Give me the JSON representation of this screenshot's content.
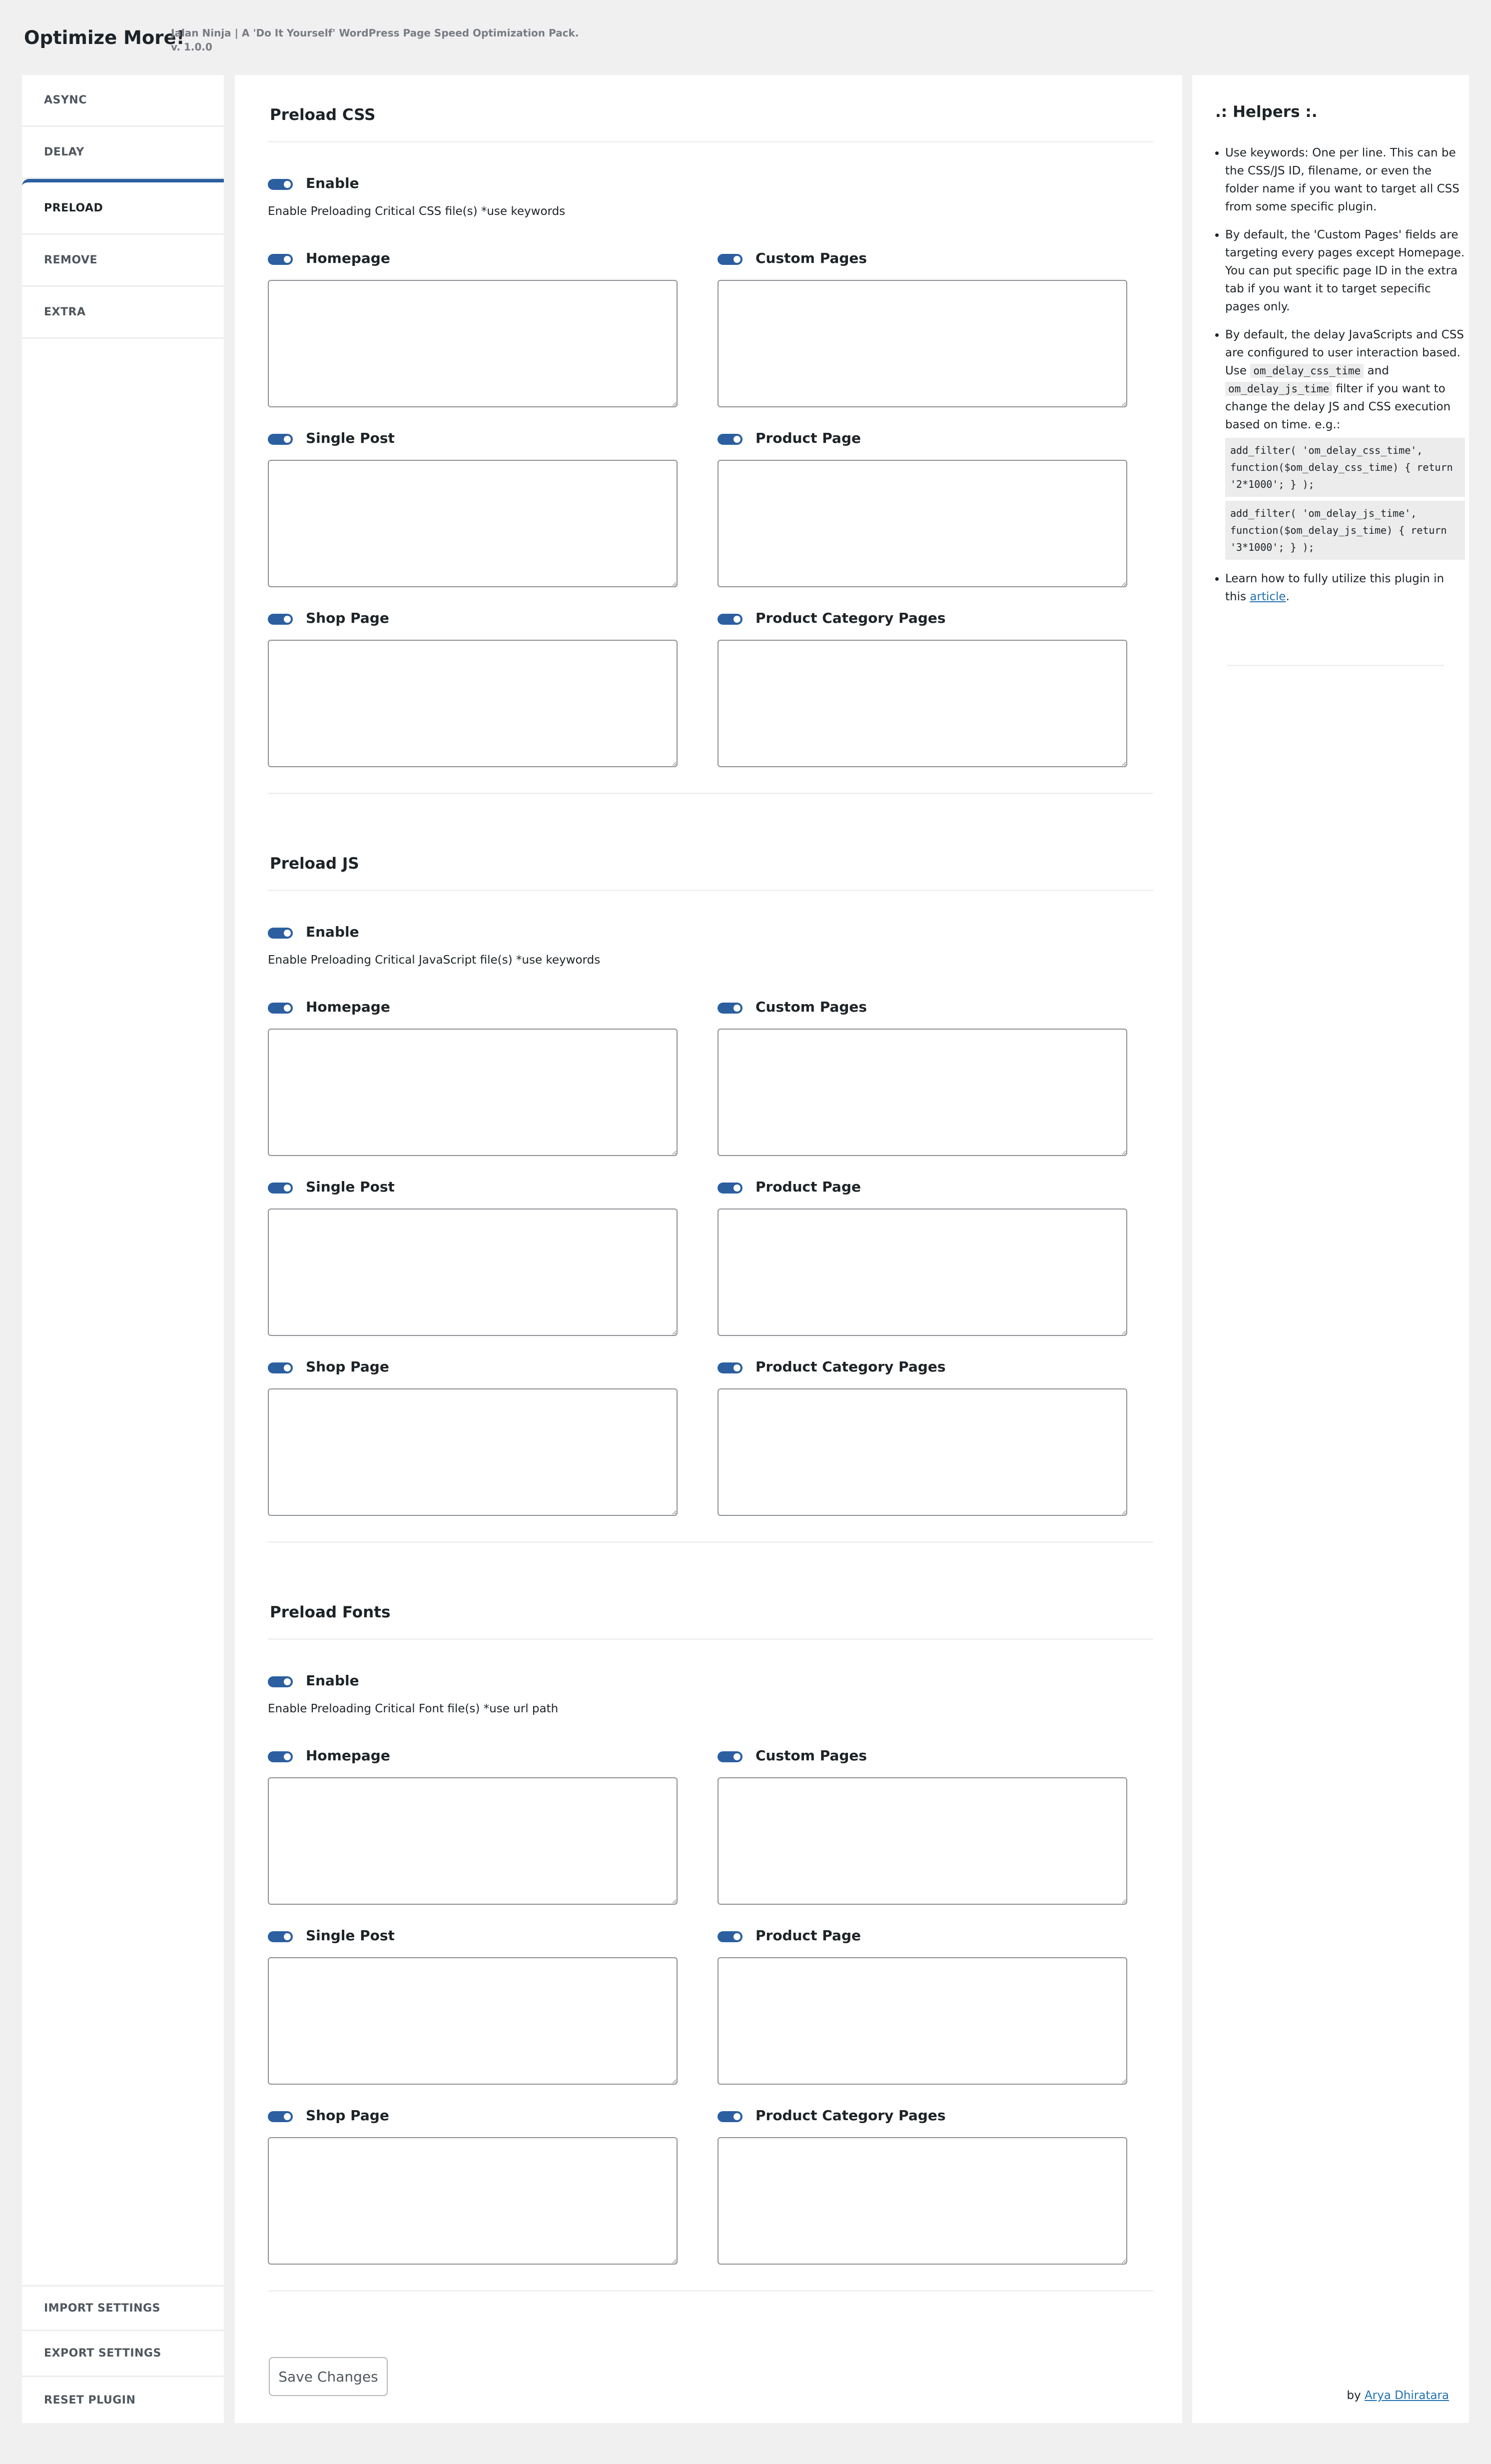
{
  "header": {
    "brand": "Optimize More!",
    "tagline": "Jalan Ninja | A 'Do It Yourself' WordPress Page Speed Optimization Pack.",
    "version": "v. 1.0.0"
  },
  "nav": {
    "items": [
      {
        "label": "ASYNC"
      },
      {
        "label": "DELAY"
      },
      {
        "label": "PRELOAD"
      },
      {
        "label": "REMOVE"
      },
      {
        "label": "EXTRA"
      }
    ],
    "active": "PRELOAD",
    "bottom_items": [
      {
        "label": "IMPORT SETTINGS"
      },
      {
        "label": "EXPORT SETTINGS"
      },
      {
        "label": "RESET PLUGIN"
      }
    ]
  },
  "sections": [
    {
      "title": "Preload CSS",
      "enable_label": "Enable",
      "enabled": true,
      "description": "Enable Preloading Critical CSS file(s) *use keywords",
      "fields": [
        {
          "label": "Homepage",
          "enabled": true,
          "value": ""
        },
        {
          "label": "Custom Pages",
          "enabled": true,
          "value": ""
        },
        {
          "label": "Single Post",
          "enabled": true,
          "value": ""
        },
        {
          "label": "Product Page",
          "enabled": true,
          "value": ""
        },
        {
          "label": "Shop Page",
          "enabled": true,
          "value": ""
        },
        {
          "label": "Product Category Pages",
          "enabled": true,
          "value": ""
        }
      ]
    },
    {
      "title": "Preload JS",
      "enable_label": "Enable",
      "enabled": true,
      "description": "Enable Preloading Critical JavaScript file(s) *use keywords",
      "fields": [
        {
          "label": "Homepage",
          "enabled": true,
          "value": ""
        },
        {
          "label": "Custom Pages",
          "enabled": true,
          "value": ""
        },
        {
          "label": "Single Post",
          "enabled": true,
          "value": ""
        },
        {
          "label": "Product Page",
          "enabled": true,
          "value": ""
        },
        {
          "label": "Shop Page",
          "enabled": true,
          "value": ""
        },
        {
          "label": "Product Category Pages",
          "enabled": true,
          "value": ""
        }
      ]
    },
    {
      "title": "Preload Fonts",
      "enable_label": "Enable",
      "enabled": true,
      "description": "Enable Preloading Critical Font file(s) *use url path",
      "fields": [
        {
          "label": "Homepage",
          "enabled": true,
          "value": ""
        },
        {
          "label": "Custom Pages",
          "enabled": true,
          "value": ""
        },
        {
          "label": "Single Post",
          "enabled": true,
          "value": ""
        },
        {
          "label": "Product Page",
          "enabled": true,
          "value": ""
        },
        {
          "label": "Shop Page",
          "enabled": true,
          "value": ""
        },
        {
          "label": "Product Category Pages",
          "enabled": true,
          "value": ""
        }
      ]
    }
  ],
  "save_label": "Save Changes",
  "helpers": {
    "title": ".: Helpers :.",
    "item1": "Use keywords: One per line. This can be the CSS/JS ID, filename, or even the folder name if you want to target all CSS from some specific plugin.",
    "item2": "By default, the 'Custom Pages' fields are targeting every pages except Homepage. You can put specific page ID in the extra tab if you want it to target sepecific pages only.",
    "item3_intro": "By default, the delay JavaScripts and CSS are configured to user interaction based.",
    "item3_use": "Use",
    "item3_code1": "om_delay_css_time",
    "item3_and": "and",
    "item3_code2": "om_delay_js_time",
    "item3_rest": "filter if you want to change the delay JS and CSS execution based on time. e.g.:",
    "code_example1": "add_filter( 'om_delay_css_time', function($om_delay_css_time) { return '2*1000'; } );",
    "code_example2": "add_filter( 'om_delay_js_time', function($om_delay_js_time) { return '3*1000'; } );",
    "item4_text": "Learn how to fully utilize this plugin in this",
    "item4_link": "article",
    "item4_end": "."
  },
  "credit": {
    "prefix": "by",
    "author": "Arya Dhiratara"
  },
  "colors": {
    "accent": "#2c5fa0",
    "background": "#f0f0f1",
    "panel": "#ffffff",
    "link": "#2271b1"
  }
}
